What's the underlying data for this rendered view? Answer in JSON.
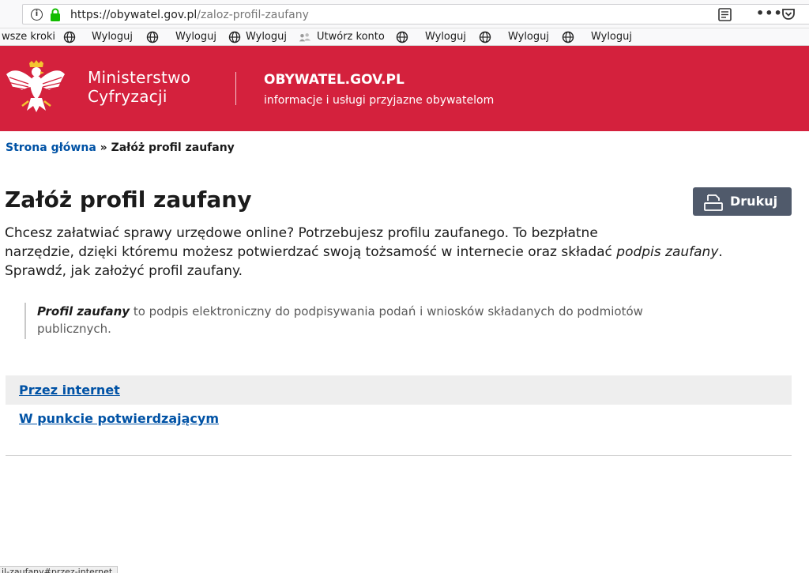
{
  "browser": {
    "url_host": "https://obywatel.gov.pl",
    "url_path": "/zaloz-profil-zaufany",
    "bookmarks": [
      "wsze kroki",
      "Wyloguj",
      "Wyloguj",
      "Wyloguj",
      "Utwórz konto",
      "Wyloguj",
      "Wyloguj",
      "Wyloguj"
    ],
    "status_url": "il-zaufany#przez-internet"
  },
  "header": {
    "ministry_line1": "Ministerstwo",
    "ministry_line2": "Cyfryzacji",
    "portal_title": "OBYWATEL.GOV.PL",
    "portal_subtitle": "informacje i usługi przyjazne obywatelom"
  },
  "breadcrumb": {
    "home": "Strona główna",
    "separator": "»",
    "current": "Załóż profil zaufany"
  },
  "page": {
    "title": "Załóż profil zaufany",
    "print_label": "Drukuj",
    "intro_line1": "Chcesz załatwiać sprawy urzędowe online? Potrzebujesz profilu zaufanego. To bezpłatne",
    "intro_line2a": "narzędzie, dzięki któremu możesz potwierdzać swoją tożsamość w internecie oraz składać ",
    "intro_line2b": "podpis zaufany",
    "intro_line2c": ".",
    "intro_line3": "Sprawdź, jak założyć profil zaufany.",
    "quote_term": "Profil zaufany",
    "quote_line1": " to podpis elektroniczny do podpisywania podań i wniosków składanych do podmiotów",
    "quote_line2": "publicznych.",
    "option1": "Przez internet",
    "option2": "W punkcie potwierdzającym"
  },
  "colors": {
    "header_red": "#d4213d",
    "link_blue": "#0052a5",
    "print_button": "#505a6b"
  }
}
